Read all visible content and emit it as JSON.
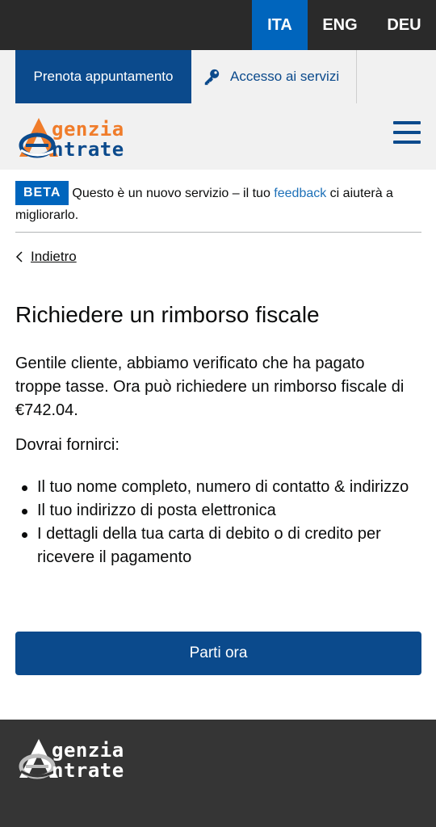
{
  "languages": [
    {
      "label": "ITA",
      "active": true
    },
    {
      "label": "ENG",
      "active": false
    },
    {
      "label": "DEU",
      "active": false
    }
  ],
  "topnav": {
    "book_label": "Prenota appuntamento",
    "access_label": "Accesso ai servizi",
    "access_icon": "key-icon"
  },
  "logo": {
    "line1": "genzia",
    "line2": "ntrate"
  },
  "beta": {
    "tag": "BETA",
    "text_before": "Questo è un nuovo servizio – il tuo ",
    "link": "feedback",
    "text_after": " ci aiuterà a migliorarlo."
  },
  "back_label": "Indietro",
  "main": {
    "title": "Richiedere un rimborso fiscale",
    "intro": "Gentile cliente, abbiamo verificato che ha pagato troppe tasse. Ora può richiedere un rimborso fiscale di €742.04.",
    "subhead": "Dovrai fornirci:",
    "bullets": [
      "Il tuo nome completo, numero di contatto & indirizzo",
      "Il tuo indirizzo di posta elettronica",
      "I dettagli della tua carta di debito o di credito per ricevere il pagamento"
    ],
    "button": "Parti ora"
  },
  "footer_logo": {
    "line1": "genzia",
    "line2": "ntrate"
  },
  "colors": {
    "brand_blue": "#0b4a8c",
    "active_lang": "#0065bd",
    "logo_orange": "#f07c2a",
    "footer": "#353535"
  }
}
